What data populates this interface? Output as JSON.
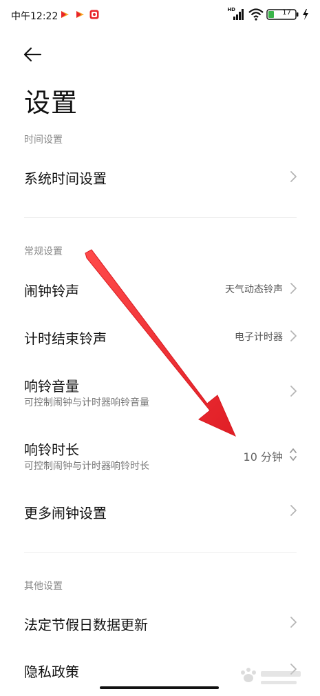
{
  "status_bar": {
    "time": "中午12:22",
    "hd": "HD",
    "battery": "17"
  },
  "header": {
    "title": "设置"
  },
  "sections": {
    "time": {
      "header": "时间设置",
      "items": [
        {
          "title": "系统时间设置"
        }
      ]
    },
    "general": {
      "header": "常规设置",
      "items": [
        {
          "title": "闹钟铃声",
          "value": "天气动态铃声"
        },
        {
          "title": "计时结束铃声",
          "value": "电子计时器"
        },
        {
          "title": "响铃音量",
          "subtitle": "可控制闹钟与计时器响铃音量"
        },
        {
          "title": "响铃时长",
          "subtitle": "可控制闹钟与计时器响铃时长",
          "value": "10 分钟"
        },
        {
          "title": "更多闹钟设置"
        }
      ]
    },
    "other": {
      "header": "其他设置",
      "items": [
        {
          "title": "法定节假日数据更新"
        },
        {
          "title": "隐私政策"
        }
      ]
    }
  },
  "colors": {
    "arrow": "#e8252b",
    "text_primary": "#111111",
    "text_secondary": "#8a8a8a",
    "chevron": "#b5b5b5"
  }
}
